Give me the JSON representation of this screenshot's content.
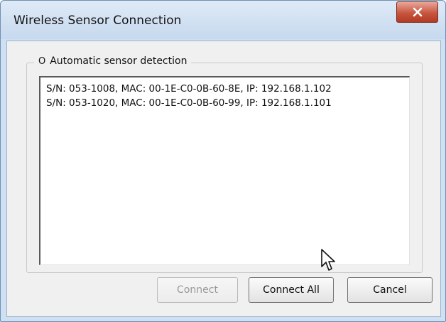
{
  "window": {
    "title": "Wireless Sensor Connection",
    "close_icon": "close-x-icon"
  },
  "group": {
    "radio_symbol": "O",
    "label": "Automatic sensor detection"
  },
  "sensors": [
    "S/N: 053-1008, MAC: 00-1E-C0-0B-60-8E, IP: 192.168.1.102",
    "S/N: 053-1020, MAC: 00-1E-C0-0B-60-99, IP: 192.168.1.101"
  ],
  "buttons": {
    "connect_label": "Connect",
    "connect_enabled": false,
    "connect_all_label": "Connect All",
    "cancel_label": "Cancel"
  },
  "colors": {
    "close_button": "#c7553f",
    "disabled_text": "#9a9a9a",
    "window_frame": "#cfe0f3"
  }
}
